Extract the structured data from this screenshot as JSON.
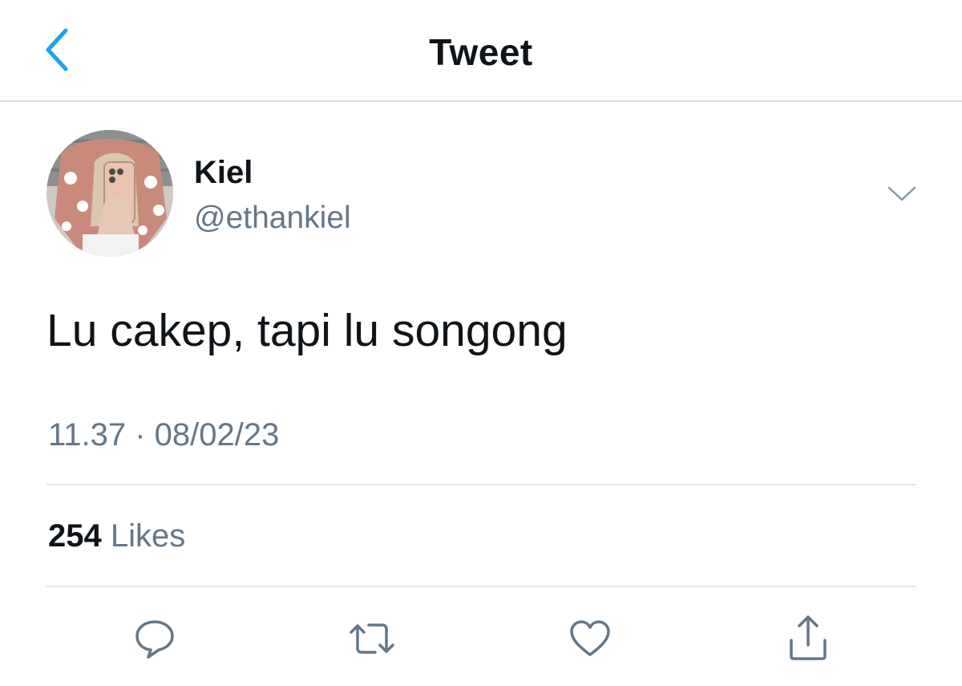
{
  "header": {
    "back_icon": "chevron-left-icon",
    "title": "Tweet"
  },
  "tweet": {
    "author": {
      "display_name": "Kiel",
      "handle": "@ethankiel",
      "avatar": "avatar-photo"
    },
    "more_icon": "chevron-down-icon",
    "text": "Lu cakep, tapi lu songong",
    "timestamp": "11.37 · 08/02/23",
    "likes": {
      "count": "254",
      "label": "Likes"
    }
  },
  "actions": [
    {
      "name": "reply",
      "icon": "reply-icon"
    },
    {
      "name": "retweet",
      "icon": "retweet-icon"
    },
    {
      "name": "like",
      "icon": "heart-icon"
    },
    {
      "name": "share",
      "icon": "share-icon"
    }
  ],
  "colors": {
    "accent": "#1da1f2",
    "text_primary": "#0f1419",
    "text_secondary": "#657786",
    "divider": "#e1e4e7",
    "icon_gray": "#657786"
  }
}
